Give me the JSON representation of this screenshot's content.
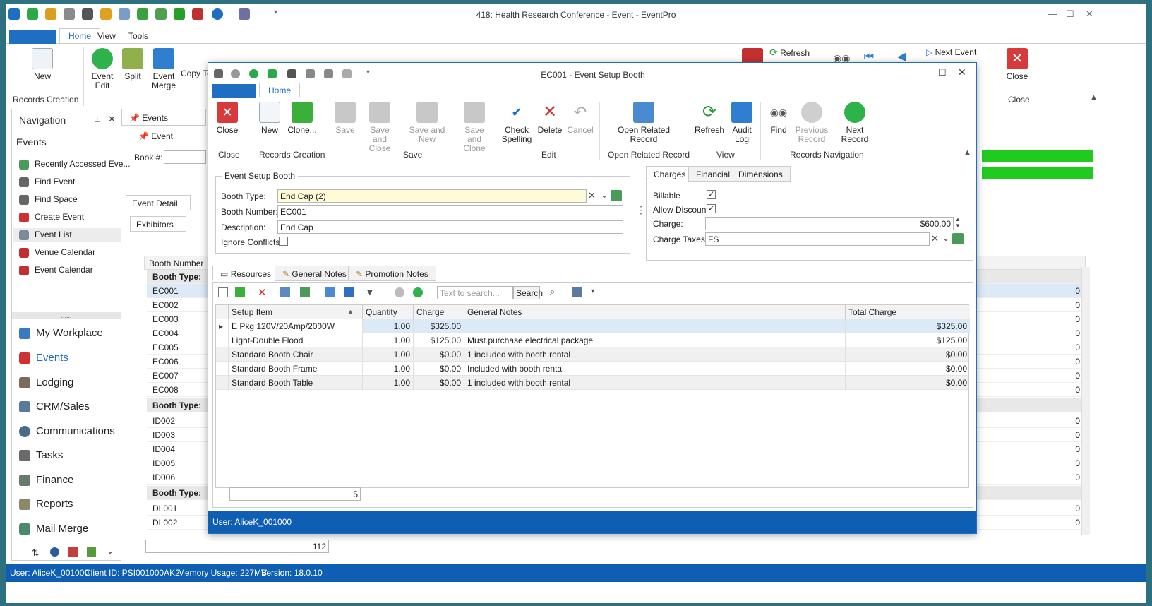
{
  "window": {
    "title": "418: Health Research Conference - Event - EventPro",
    "tabs": [
      "Home",
      "View",
      "Tools"
    ]
  },
  "ribbon": {
    "new_label": "New",
    "event_edit_label": "Event Edit",
    "split_label": "Split",
    "event_merge_label": "Event Merge",
    "copy_label": "Copy Te",
    "records_creation_label": "Records Creation",
    "refresh_label": "Refresh",
    "next_event_label": "Next Event",
    "close_label": "Close",
    "close_group_label": "Close"
  },
  "navigation": {
    "title": "Navigation",
    "section": "Events",
    "items": [
      {
        "label": "Recently Accessed Eve...",
        "icon": "clock-icon"
      },
      {
        "label": "Find Event",
        "icon": "binoculars-icon"
      },
      {
        "label": "Find Space",
        "icon": "binoculars-icon"
      },
      {
        "label": "Create Event",
        "icon": "pushpin-icon"
      },
      {
        "label": "Event List",
        "icon": "list-icon"
      },
      {
        "label": "Venue Calendar",
        "icon": "calendar-icon"
      },
      {
        "label": "Event Calendar",
        "icon": "calendar-icon"
      }
    ],
    "modules": [
      {
        "label": "My Workplace"
      },
      {
        "label": "Events"
      },
      {
        "label": "Lodging"
      },
      {
        "label": "CRM/Sales"
      },
      {
        "label": "Communications"
      },
      {
        "label": "Tasks"
      },
      {
        "label": "Finance"
      },
      {
        "label": "Reports"
      },
      {
        "label": "Mail Merge"
      }
    ]
  },
  "main": {
    "doc_tab": "Events",
    "event_label": "Event",
    "book_label": "Book #:",
    "event_detail_tab": "Event Detail",
    "exhibitors_tab": "Exhibitors",
    "grid_header": "Booth Number",
    "group_label": "Booth Type:",
    "rows_group1": [
      "EC001",
      "EC002",
      "EC003",
      "EC004",
      "EC005",
      "EC006",
      "EC007",
      "EC008"
    ],
    "rows_group2": [
      "ID002",
      "ID003",
      "ID004",
      "ID005",
      "ID006"
    ],
    "rows_group3": [
      "DL001",
      "DL002"
    ],
    "row_value": "0",
    "count": "112"
  },
  "status": {
    "user": "User: AliceK_001000",
    "client": "Client ID: PSI001000AK2",
    "memory": "Memory Usage: 227MB",
    "version": "Version: 18.0.10"
  },
  "dialog": {
    "title": "EC001 - Event Setup Booth",
    "tab": "Home",
    "buttons": {
      "close": "Close",
      "new": "New",
      "clone": "Clone...",
      "save": "Save",
      "save_and_close": "Save and Close",
      "save_and_new": "Save and New",
      "save_and_clone": "Save and Clone",
      "check_spelling": "Check Spelling",
      "delete": "Delete",
      "cancel": "Cancel",
      "open_related_record": "Open Related Record",
      "refresh": "Refresh",
      "audit_log": "Audit Log",
      "find": "Find",
      "previous_record": "Previous Record",
      "next_record": "Next Record"
    },
    "groups": {
      "close": "Close",
      "records_creation": "Records Creation",
      "save": "Save",
      "edit": "Edit",
      "open_related_record": "Open Related Record",
      "view": "View",
      "records_navigation": "Records Navigation"
    },
    "form": {
      "group_title": "Event Setup Booth",
      "booth_type_label": "Booth Type:",
      "booth_type_value": "End Cap (2)",
      "booth_number_label": "Booth Number:",
      "booth_number_value": "EC001",
      "description_label": "Description:",
      "description_value": "End Cap",
      "ignore_conflicts_label": "Ignore Conflicts"
    },
    "charges_tabs": [
      "Charges",
      "Financial",
      "Dimensions"
    ],
    "charges": {
      "billable_label": "Billable",
      "allow_discount_label": "Allow Discount",
      "charge_label": "Charge:",
      "charge_value": "$600.00",
      "charge_taxes_label": "Charge Taxes:",
      "charge_taxes_value": "FS"
    },
    "lower_tabs": [
      "Resources",
      "General Notes",
      "Promotion Notes"
    ],
    "search_placeholder": "Text to search...",
    "search_button": "Search",
    "columns": [
      "Setup Item",
      "Quantity",
      "Charge",
      "General Notes",
      "Total Charge"
    ],
    "rows": [
      {
        "item": "E Pkg 120V/20Amp/2000W",
        "qty": "1.00",
        "charge": "$325.00",
        "notes": "",
        "total": "$325.00"
      },
      {
        "item": "Light-Double Flood",
        "qty": "1.00",
        "charge": "$125.00",
        "notes": "Must purchase electrical package",
        "total": "$125.00"
      },
      {
        "item": "Standard Booth Chair",
        "qty": "1.00",
        "charge": "$0.00",
        "notes": "1 included with booth rental",
        "total": "$0.00"
      },
      {
        "item": "Standard Booth Frame",
        "qty": "1.00",
        "charge": "$0.00",
        "notes": "Included with booth rental",
        "total": "$0.00"
      },
      {
        "item": "Standard Booth Table",
        "qty": "1.00",
        "charge": "$0.00",
        "notes": "1 included with booth rental",
        "total": "$0.00"
      }
    ],
    "row_count": "5",
    "status_user": "User: AliceK_001000"
  }
}
